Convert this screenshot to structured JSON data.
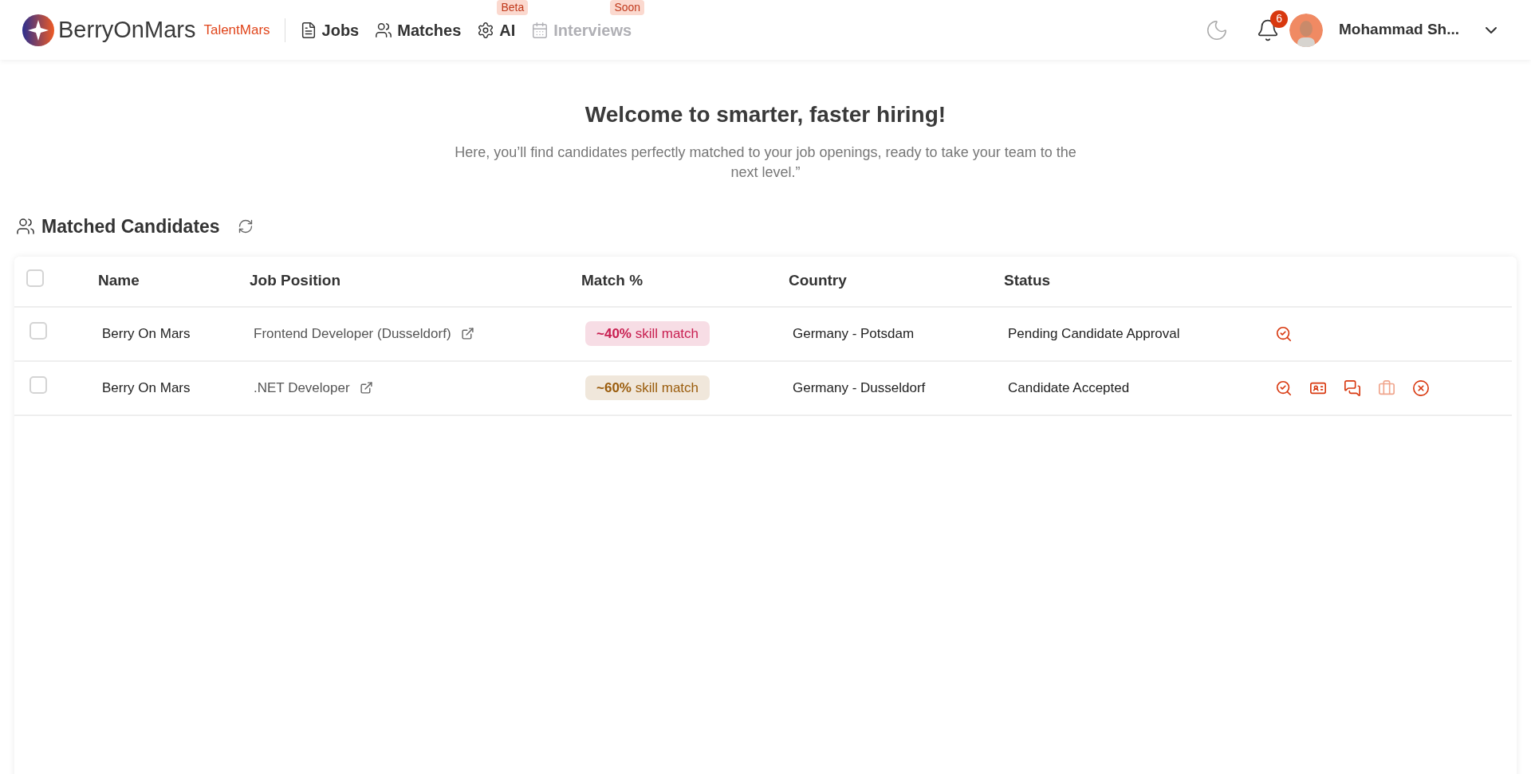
{
  "header": {
    "brand": "BerryOnMars",
    "product": "TalentMars",
    "nav": [
      {
        "label": "Jobs",
        "kind": "jobs",
        "disabled": false
      },
      {
        "label": "Matches",
        "kind": "matches",
        "disabled": false
      },
      {
        "label": "AI",
        "kind": "ai",
        "disabled": false,
        "badge": "Beta"
      },
      {
        "label": "Interviews",
        "kind": "interviews",
        "disabled": true,
        "badge": "Soon"
      }
    ],
    "notifications": "6",
    "user": "Mohammad Sh..."
  },
  "intro": {
    "title": "Welcome to smarter, faster hiring!",
    "text": "Here, you’ll find candidates perfectly matched to your job openings, ready to take your team to the next level.”"
  },
  "section": {
    "title": "Matched Candidates"
  },
  "table": {
    "select_all": {
      "checked": false
    },
    "columns": [
      "Name",
      "Job Position",
      "Match %",
      "Country",
      "Status"
    ],
    "rows": [
      {
        "checked": false,
        "name": "Berry On Mars",
        "job": "Frontend Developer (Dusseldorf)",
        "match": "**~40%** skill match",
        "color": "#c81e50",
        "country": "Germany - Potsdam",
        "status": "Pending Candidate Approval",
        "actions": [
          {
            "kind": "view",
            "disabled": false
          }
        ]
      },
      {
        "checked": false,
        "name": "Berry On Mars",
        "job": ".NET Developer",
        "match": "**~60%** skill match",
        "color": "#9a5c0c",
        "country": "Germany - Dusseldorf",
        "status": "Candidate Accepted",
        "actions": [
          {
            "kind": "view",
            "disabled": false
          },
          {
            "kind": "profile",
            "disabled": false
          },
          {
            "kind": "chat",
            "disabled": false
          },
          {
            "kind": "offer",
            "disabled": true
          },
          {
            "kind": "reject",
            "disabled": false
          }
        ]
      }
    ]
  }
}
